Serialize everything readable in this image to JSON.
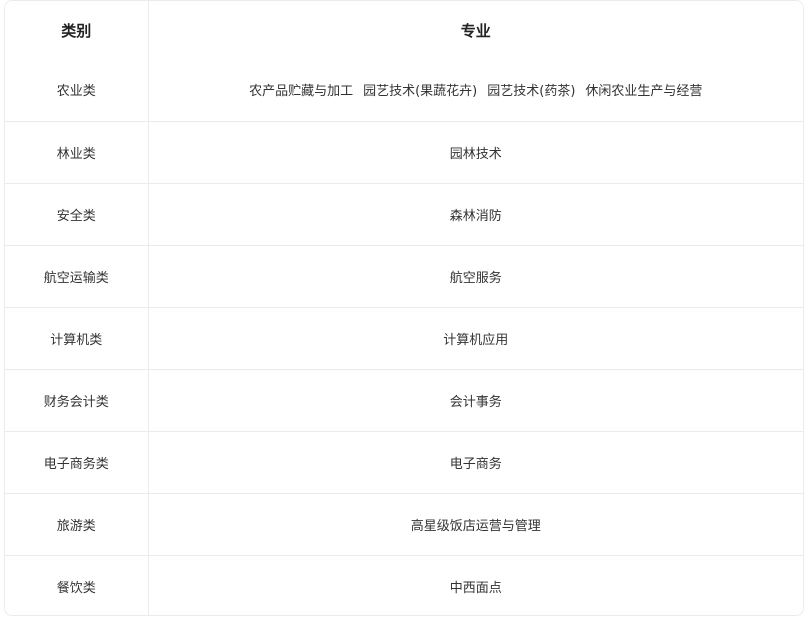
{
  "table": {
    "headers": [
      "类别",
      "专业"
    ],
    "rows": [
      {
        "category": "农业类",
        "majors": [
          "农产品贮藏与加工",
          "园艺技术(果蔬花卉)",
          "园艺技术(药茶)",
          "休闲农业生产与经营"
        ]
      },
      {
        "category": "林业类",
        "majors": [
          "园林技术"
        ]
      },
      {
        "category": "安全类",
        "majors": [
          "森林消防"
        ]
      },
      {
        "category": "航空运输类",
        "majors": [
          "航空服务"
        ]
      },
      {
        "category": "计算机类",
        "majors": [
          "计算机应用"
        ]
      },
      {
        "category": "财务会计类",
        "majors": [
          "会计事务"
        ]
      },
      {
        "category": "电子商务类",
        "majors": [
          "电子商务"
        ]
      },
      {
        "category": "旅游类",
        "majors": [
          "高星级饭店运营与管理"
        ]
      },
      {
        "category": "餐饮类",
        "majors": [
          "中西面点"
        ]
      }
    ]
  }
}
